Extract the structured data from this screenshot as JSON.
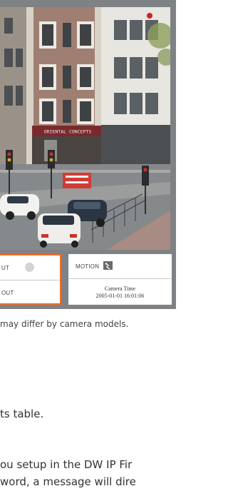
{
  "viewer": {
    "left_panel": {
      "label_top": "UT",
      "label_bottom": "OUT"
    },
    "right_panel": {
      "motion_label": "MOTION",
      "camera_time_label": "Camera Time",
      "camera_time_value": "2005-01-01 16:01:06"
    },
    "scene": {
      "shop_sign": "ORIENTAL CONCEPTS"
    }
  },
  "text": {
    "caption": "may differ by camera models.",
    "line1": "ts table.",
    "line2": "ou setup in the DW IP Fir",
    "line3": "word, a message will dire"
  },
  "colors": {
    "accent": "#f26d21",
    "frame": "#7f8284"
  },
  "icons": {
    "left_panel": "status-dot-icon",
    "right_panel": "motion-icon"
  }
}
